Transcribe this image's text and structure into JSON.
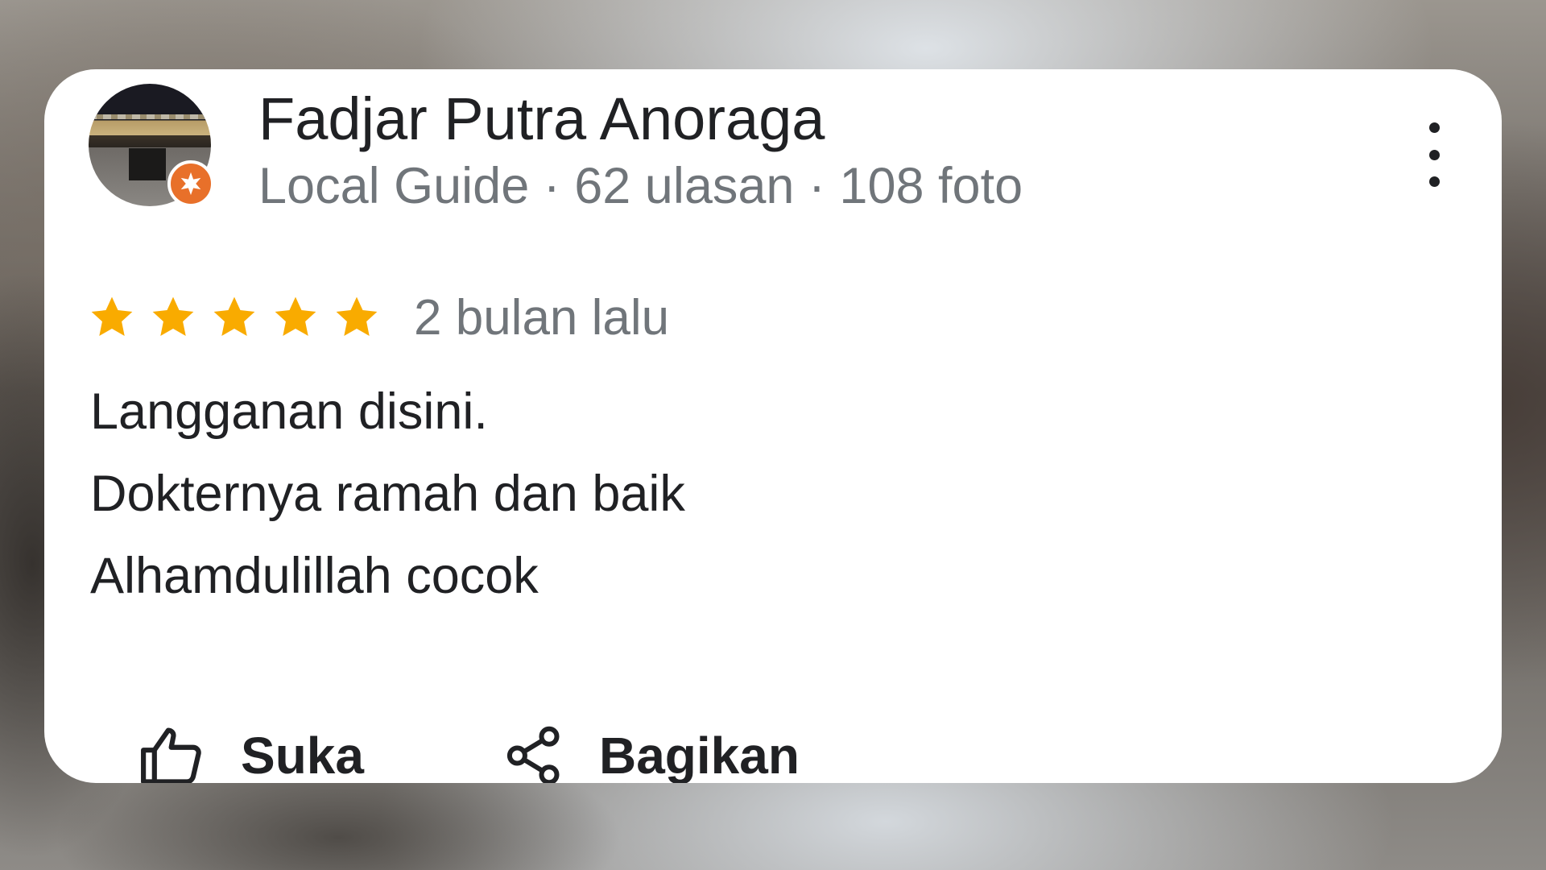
{
  "review": {
    "reviewer_name": "Fadjar Putra Anoraga",
    "reviewer_meta": "Local Guide · 62 ulasan · 108 foto",
    "rating": 5,
    "rating_max": 5,
    "date": "2 bulan lalu",
    "text_lines": [
      "Langganan disini.",
      "Dokternya ramah dan baik",
      "Alhamdulillah cocok"
    ]
  },
  "actions": {
    "like_label": "Suka",
    "share_label": "Bagikan"
  },
  "icons": {
    "avatar": "reviewer-avatar",
    "badge": "local-guide-badge-icon",
    "more": "more-vert-icon",
    "star": "star-icon",
    "like": "thumb-up-icon",
    "share": "share-icon"
  },
  "colors": {
    "star": "#F9AB00",
    "badge": "#E8702A",
    "text_primary": "#202124",
    "text_secondary": "#70757A",
    "card_background": "#FFFFFF"
  }
}
